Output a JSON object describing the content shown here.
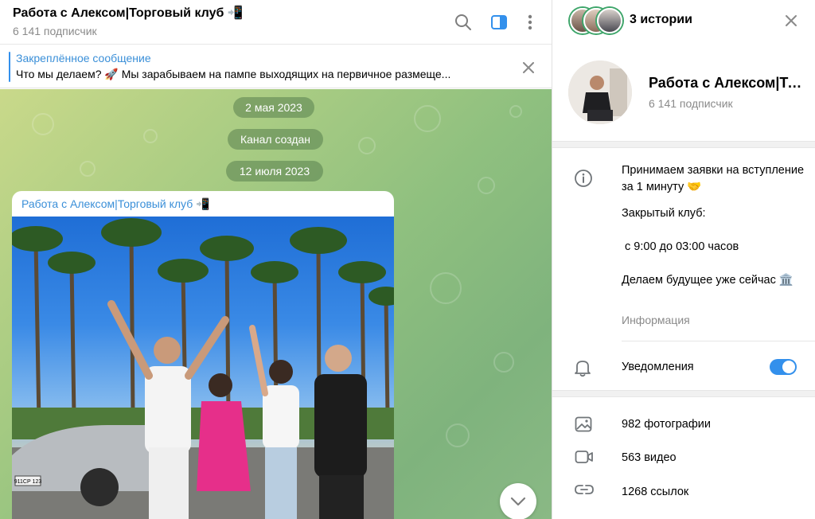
{
  "chat": {
    "title": "Работа с Алексом|Торговый клуб 📲",
    "subscribers": "6 141 подписчик"
  },
  "pinned": {
    "title": "Закреплённое сообщение",
    "text": "Что мы делаем? 🚀  Мы зарабываем на пампе выходящих на первичное размеще..."
  },
  "timeline": {
    "date1": "2 мая 2023",
    "service": "Канал создан",
    "date2": "12 июля 2023"
  },
  "post": {
    "author": "Работа с Алексом|Торговый клуб 📲",
    "plate": "911СР 123"
  },
  "profile": {
    "stories_label": "3 истории",
    "name": "Работа с Алексом|Торговый клуб 📲",
    "subscribers": "6 141 подписчик",
    "about": [
      "Принимаем заявки на вступление за 1 минуту 🤝",
      "Закрытый клуб:",
      " с 9:00 до 03:00 часов",
      "Делаем будущее уже сейчас 🏛️"
    ],
    "info_caption": "Информация",
    "notifications_label": "Уведомления",
    "notifications_on": true,
    "media": [
      {
        "label": "982 фотографии",
        "icon": "photo-icon"
      },
      {
        "label": "563 видео",
        "icon": "video-icon"
      },
      {
        "label": "1268 ссылок",
        "icon": "link-icon"
      }
    ]
  },
  "colors": {
    "accent": "#3390ec",
    "link": "#3a8fd8",
    "story_ring": "#3ea56a"
  }
}
